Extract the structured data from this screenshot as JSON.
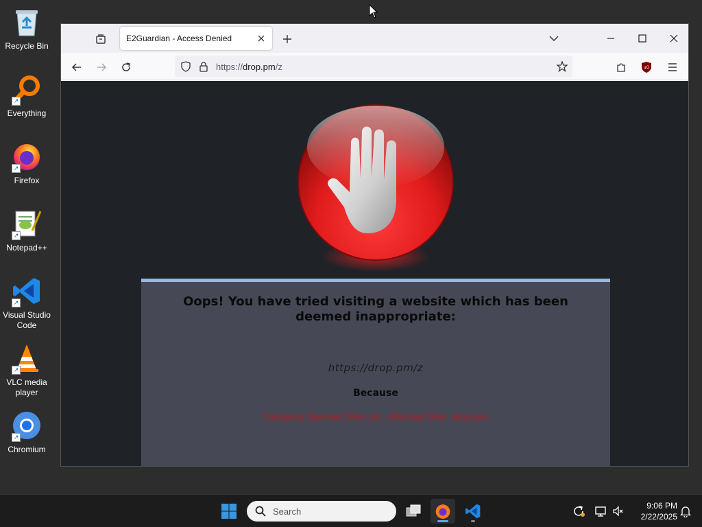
{
  "desktop": {
    "icons": [
      {
        "label": "Recycle Bin"
      },
      {
        "label": "Everything"
      },
      {
        "label": "Firefox"
      },
      {
        "label": "Notepad++"
      },
      {
        "label": "Visual Studio Code"
      },
      {
        "label": "VLC media player"
      },
      {
        "label": "Chromium"
      }
    ]
  },
  "browser": {
    "tab": {
      "title": "E2Guardian - Access Denied"
    },
    "url": {
      "scheme": "https://",
      "host": "drop.pm",
      "path": "/z"
    }
  },
  "page": {
    "heading": "Oops! You have tried visiting a website which has been deemed inappropriate:",
    "blocked_url": "https://drop.pm/z",
    "because_label": "Because",
    "reason": "Category: Banned Site List - Blocked Site: drop.pm"
  },
  "taskbar": {
    "search_placeholder": "Search",
    "time": "9:06 PM",
    "date": "2/22/2025"
  },
  "colors": {
    "accent": "#60a5fa",
    "denied_red": "#e01b1b",
    "panel_bg": "#464955",
    "page_bg": "#1f2227"
  }
}
